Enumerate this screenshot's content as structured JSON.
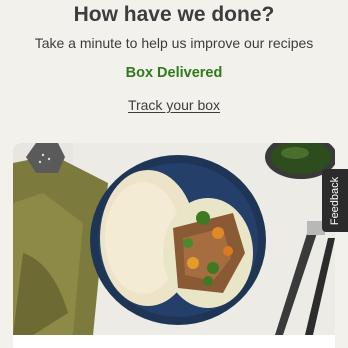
{
  "header": {
    "title": "How have we done?",
    "subtitle": "Take a minute to help us improve our recipes",
    "status": "Box Delivered",
    "track_link": "Track your box"
  },
  "recipe_card": {
    "image": "recipe-meal-photo"
  },
  "feedback_tab": {
    "label": "Feedback"
  },
  "colors": {
    "background": "#f2f1ec",
    "status_green": "#2f7a1b",
    "text": "#3d3d3d",
    "feedback_tab": "#2b2b2b"
  }
}
